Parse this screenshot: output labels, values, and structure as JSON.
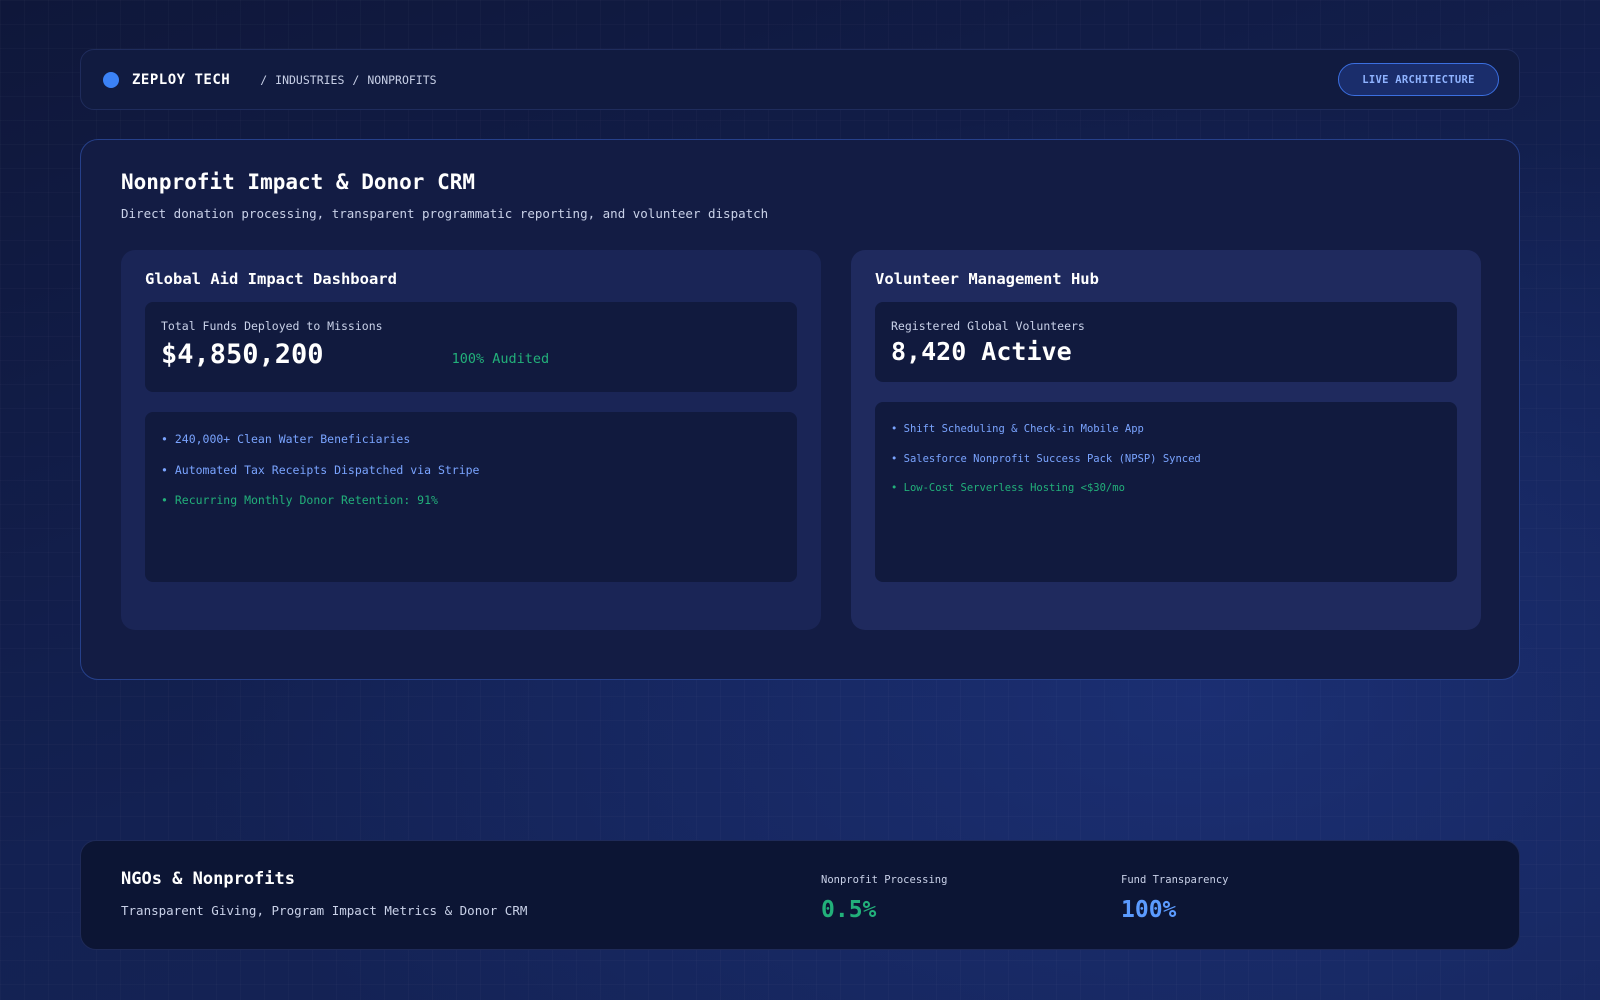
{
  "header": {
    "brand": "ZEPLOY TECH",
    "breadcrumbs": [
      "INDUSTRIES",
      "NONPROFITS"
    ],
    "separator": "/",
    "live_button": "LIVE ARCHITECTURE"
  },
  "main": {
    "title": "Nonprofit Impact & Donor CRM",
    "subtitle": "Direct donation processing, transparent programmatic reporting, and volunteer dispatch",
    "impact_panel": {
      "title": "Global Aid Impact Dashboard",
      "stat_label": "Total Funds Deployed to Missions",
      "stat_value": "$4,850,200",
      "stat_badge": "100% Audited",
      "items": [
        "• 240,000+ Clean Water Beneficiaries",
        "• Automated Tax Receipts Dispatched via Stripe",
        "• Recurring Monthly Donor Retention: 91%"
      ]
    },
    "volunteer_panel": {
      "title": "Volunteer Management Hub",
      "stat_label": "Registered Global Volunteers",
      "stat_value": "8,420 Active",
      "items": [
        "• Shift Scheduling & Check-in Mobile App",
        "• Salesforce Nonprofit Success Pack (NPSP) Synced",
        "• Low-Cost Serverless Hosting <$30/mo"
      ]
    }
  },
  "footer": {
    "title": "NGOs & Nonprofits",
    "subtitle": "Transparent Giving, Program Impact Metrics & Donor CRM",
    "metrics": [
      {
        "label": "Nonprofit Processing",
        "value": "0.5%"
      },
      {
        "label": "Fund Transparency",
        "value": "100%"
      }
    ]
  },
  "colors": {
    "accent_blue": "#3b82f6",
    "success_green": "#22b07a",
    "link_blue": "#7aa4ff",
    "background": "#111a40"
  }
}
